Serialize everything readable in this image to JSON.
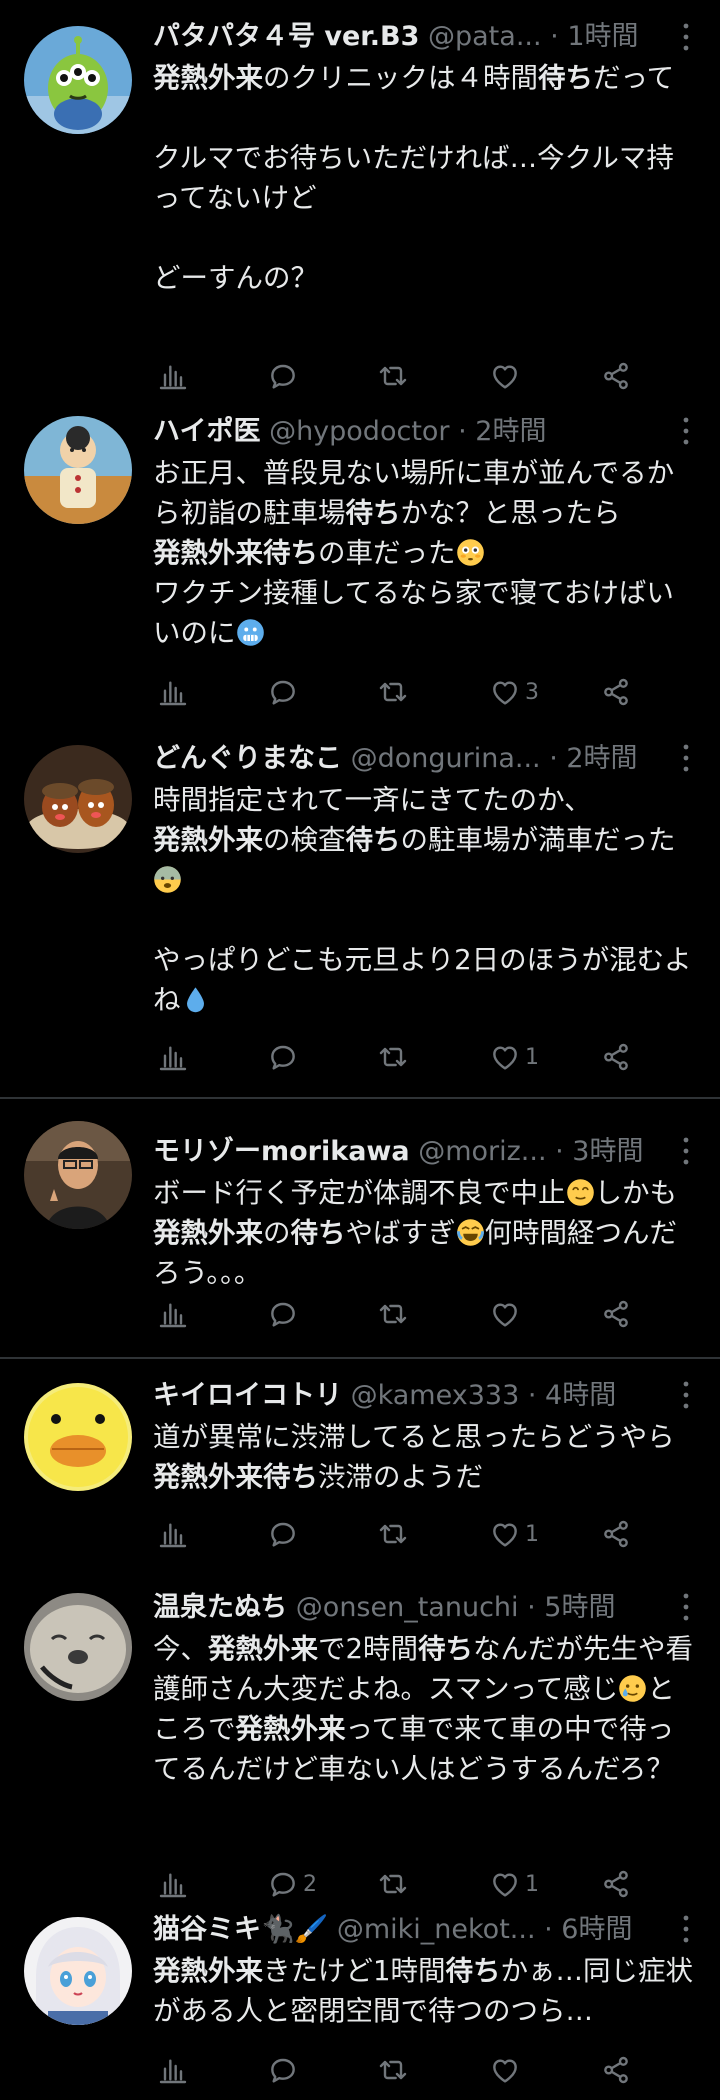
{
  "colors": {
    "background": "#000000",
    "text": "#e7e9ea",
    "secondary": "#71767b",
    "divider": "#2f3336"
  },
  "tweets": [
    {
      "name": "パタパタ４号 ver.B3",
      "handle": "@pata...",
      "dot": " · ",
      "time": "1時間",
      "avatar_icon": "green-alien-toy-avatar",
      "body_lines": [
        "発熱外来のクリニックは４時間待ちだって",
        "",
        "クルマでお待ちいただければ…今クルマ持ってないけど",
        "",
        "どーすんの？"
      ],
      "replies": "",
      "retweets": "",
      "likes": ""
    },
    {
      "name": "ハイポ医",
      "handle": "@hypodoctor",
      "dot": " · ",
      "time": "2時間",
      "avatar_icon": "costume-figure-avatar",
      "replies": "",
      "retweets": "",
      "likes": "3"
    },
    {
      "name": "どんぐりまなこ",
      "handle": "@dongurina...",
      "dot": " · ",
      "time": "2時間",
      "avatar_icon": "acorn-figures-avatar",
      "replies": "",
      "retweets": "",
      "likes": "1"
    },
    {
      "name": "モリゾーmorikawa",
      "handle": "@moriz...",
      "dot": " · ",
      "time": "3時間",
      "avatar_icon": "man-photo-avatar",
      "replies": "",
      "retweets": "",
      "likes": ""
    },
    {
      "name": "キイロイコトリ",
      "handle": "@kamex333",
      "dot": " · ",
      "time": "4時間",
      "avatar_icon": "yellow-bird-plush-avatar",
      "replies": "",
      "retweets": "",
      "likes": "1"
    },
    {
      "name": "温泉たぬち",
      "handle": "@onsen_tanuchi",
      "dot": " · ",
      "time": "5時間",
      "avatar_icon": "seal-photo-avatar",
      "replies": "2",
      "retweets": "",
      "likes": "1"
    },
    {
      "name": "猫谷ミキ🐈‍⬛🖌️",
      "handle": "@miki_nekot...",
      "dot": " · ",
      "time": "6時間",
      "avatar_icon": "anime-girl-avatar",
      "replies": "",
      "retweets": "",
      "likes": ""
    }
  ],
  "texts": {
    "t0": {
      "p1": "発熱外来",
      "p2": "のクリニックは４時間",
      "p3": "待ち",
      "p4": "だって\n\nクルマでお待ちいただければ…今クルマ持ってないけど\n\nどーすんの？"
    },
    "t1": {
      "p1": "お正月、普段見ない場所に車が並んでるから初詣の駐車場",
      "p2": "待ち",
      "p3": "かな？と思ったら\n",
      "p4": "発熱外来待ち",
      "p5": "の車だった",
      "p6": "\nワクチン接種してるなら家で寝ておけばいいのに"
    },
    "t2": {
      "p1": "時間指定されて一斉にきてたのか、\n",
      "p2": "発熱外来",
      "p3": "の検査",
      "p4": "待ち",
      "p5": "の駐車場が満車だった",
      "p6": "\n\nやっぱりどこも元旦より2日のほうが混むよね"
    },
    "t3": {
      "p1": "ボード行く予定が体調不良で中止",
      "p2": "しかも",
      "p3": "発熱外来",
      "p4": "の",
      "p5": "待ち",
      "p6": "やばすぎ",
      "p7": "何時間経つんだろう。。。"
    },
    "t4": {
      "p1": "道が異常に渋滞してると思ったらどうやら",
      "p2": "発熱外来待ち",
      "p3": "渋滞のようだ"
    },
    "t5": {
      "p1": "今、",
      "p2": "発熱外来",
      "p3": "で2時間",
      "p4": "待ち",
      "p5": "なんだが先生や看護師さん大変だよね。スマンって感じ",
      "p6": "ところで",
      "p7": "発熱外来",
      "p8": "って車で来て車の中で待ってるんだけど車ない人はどうするんだろ？"
    },
    "t6": {
      "p1": "発熱外来",
      "p2": "きたけど1時間",
      "p3": "待ち",
      "p4": "かぁ…同じ症状がある人と密閉空間で待つのつら…"
    }
  }
}
